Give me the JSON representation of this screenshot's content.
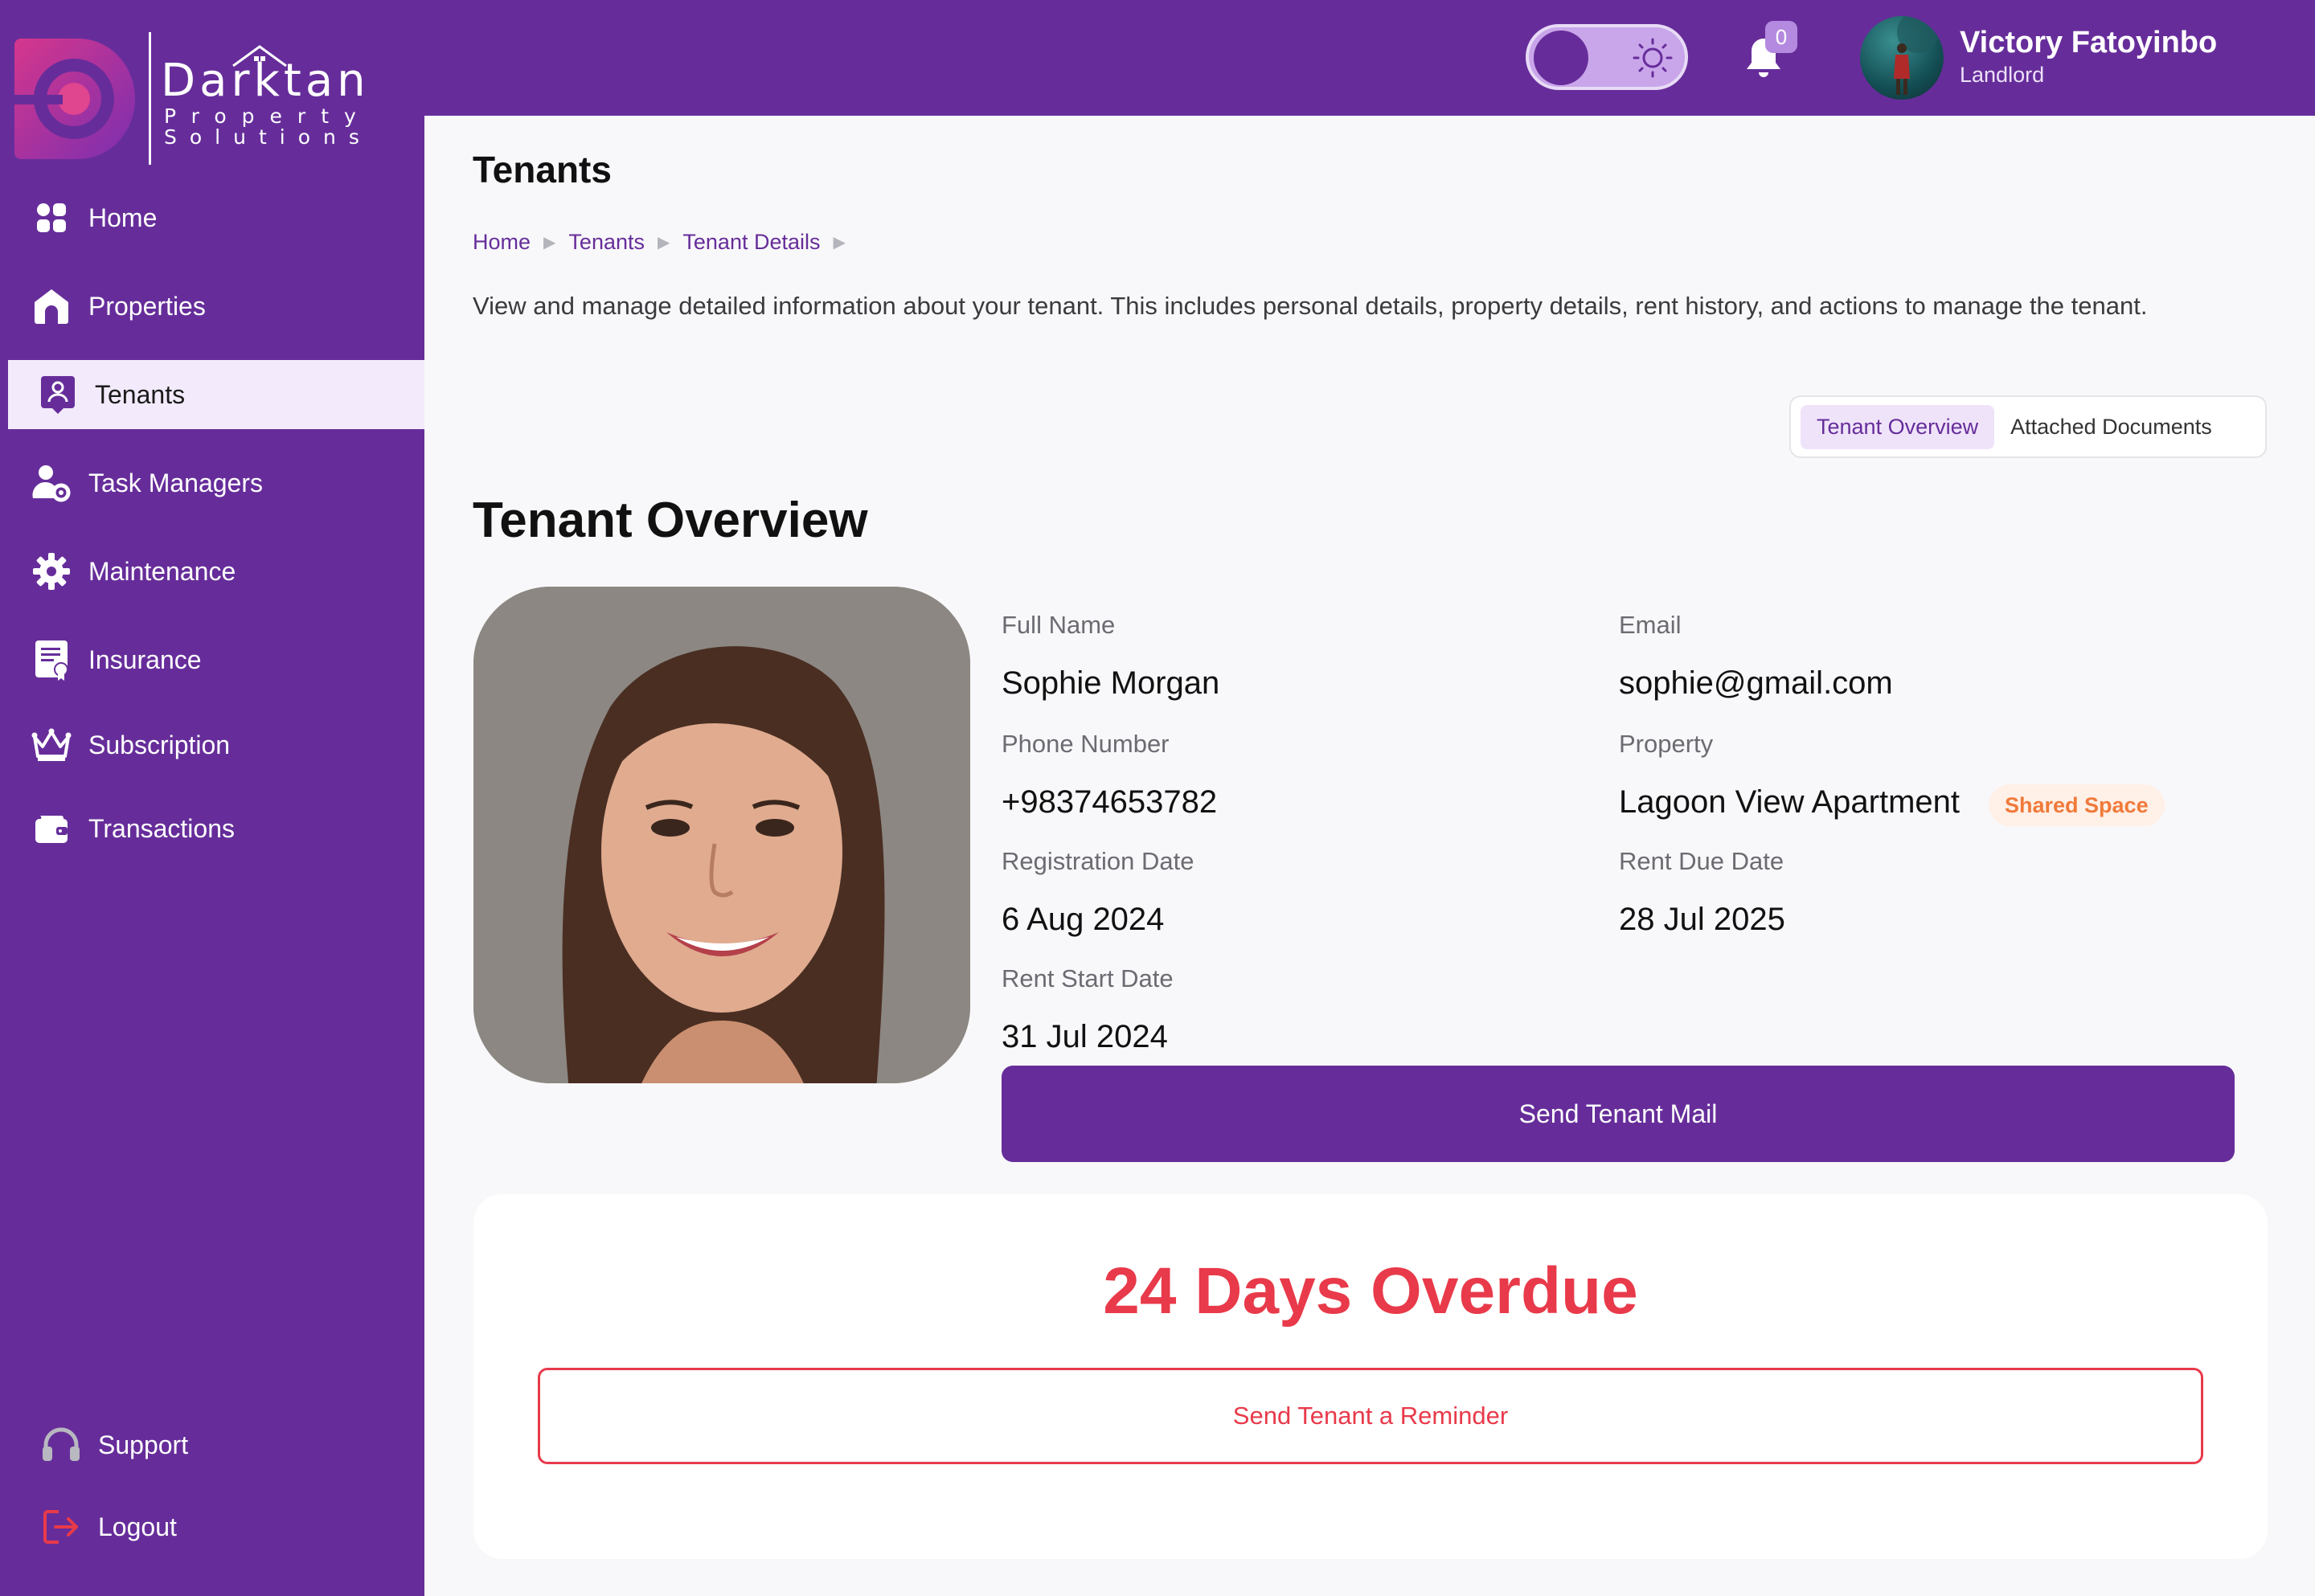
{
  "brand": {
    "name": "Darktan",
    "sub1": "Property",
    "sub2": "Solutions"
  },
  "sidebar": {
    "items": [
      {
        "label": "Home",
        "icon": "grid-icon"
      },
      {
        "label": "Properties",
        "icon": "house-icon"
      },
      {
        "label": "Tenants",
        "icon": "tenant-icon",
        "active": true
      },
      {
        "label": "Task Managers",
        "icon": "user-gear-icon"
      },
      {
        "label": "Maintenance",
        "icon": "gear-icon"
      },
      {
        "label": "Insurance",
        "icon": "certificate-icon"
      },
      {
        "label": "Subscription",
        "icon": "crown-icon"
      },
      {
        "label": "Transactions",
        "icon": "wallet-icon"
      }
    ],
    "support_label": "Support",
    "logout_label": "Logout"
  },
  "header": {
    "notification_count": "0",
    "user_name": "Victory Fatoyinbo",
    "user_role": "Landlord",
    "theme_mode": "light"
  },
  "page": {
    "title": "Tenants",
    "breadcrumb": [
      "Home",
      "Tenants",
      "Tenant Details"
    ],
    "description": "View and manage detailed information about your tenant. This includes personal details, property details, rent history, and actions to manage the tenant.",
    "tabs": [
      "Tenant Overview",
      "Attached Documents"
    ],
    "section_title": "Tenant Overview"
  },
  "tenant": {
    "full_name_label": "Full Name",
    "full_name": "Sophie Morgan",
    "email_label": "Email",
    "email": "sophie@gmail.com",
    "phone_label": "Phone Number",
    "phone": "+98374653782",
    "property_label": "Property",
    "property": "Lagoon View Apartment",
    "property_badge": "Shared Space",
    "registration_label": "Registration Date",
    "registration_date": "6 Aug 2024",
    "rent_due_label": "Rent Due Date",
    "rent_due_date": "28 Jul 2025",
    "rent_start_label": "Rent Start Date",
    "rent_start_date": "31 Jul 2024"
  },
  "actions": {
    "send_mail": "Send Tenant Mail",
    "overdue_text": "24 Days Overdue",
    "send_reminder": "Send Tenant a Reminder"
  },
  "colors": {
    "primary": "#662d9a",
    "danger": "#e83a4a",
    "badge_text": "#f07a3a",
    "background": "#f8f8fa"
  }
}
